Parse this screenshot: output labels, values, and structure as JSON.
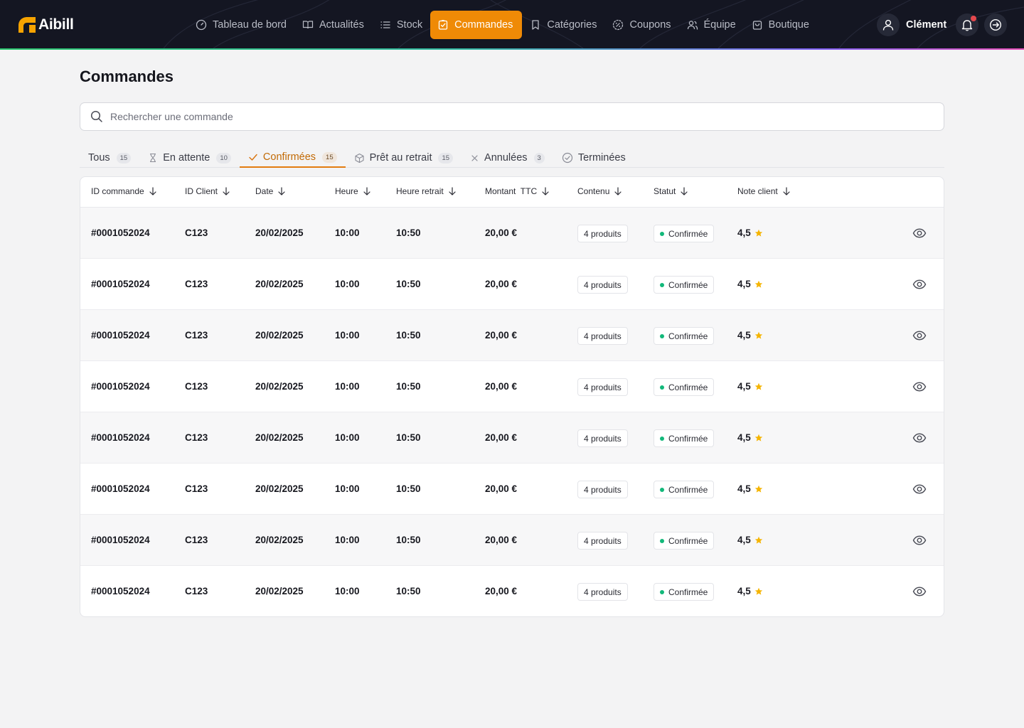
{
  "app": {
    "name": "Aibill"
  },
  "nav": {
    "items": [
      {
        "label": "Tableau de bord",
        "icon": "gauge-icon"
      },
      {
        "label": "Actualités",
        "icon": "book-open-icon"
      },
      {
        "label": "Stock",
        "icon": "list-icon"
      },
      {
        "label": "Commandes",
        "icon": "clipboard-check-icon",
        "active": true
      },
      {
        "label": "Catégories",
        "icon": "bookmark-icon"
      },
      {
        "label": "Coupons",
        "icon": "badge-percent-icon"
      },
      {
        "label": "Équipe",
        "icon": "users-icon"
      },
      {
        "label": "Boutique",
        "icon": "shopping-bag-icon"
      }
    ]
  },
  "user": {
    "name": "Clément"
  },
  "page": {
    "title": "Commandes"
  },
  "search": {
    "placeholder": "Rechercher une commande"
  },
  "tabs": [
    {
      "label": "Tous",
      "count": "15"
    },
    {
      "label": "En attente",
      "count": "10",
      "icon": "hourglass-icon"
    },
    {
      "label": "Confirmées",
      "count": "15",
      "icon": "check-icon",
      "active": true
    },
    {
      "label": "Prêt au retrait",
      "count": "15",
      "icon": "package-icon"
    },
    {
      "label": "Annulées",
      "count": "3",
      "icon": "x-icon"
    },
    {
      "label": "Terminées",
      "count": "",
      "icon": "check-circle-icon"
    }
  ],
  "table": {
    "columns": [
      "ID commande",
      "ID Client",
      "Date",
      "Heure",
      "Heure retrait",
      "Montant  TTC",
      "Contenu",
      "Statut",
      "Note client"
    ],
    "rows": [
      {
        "order_id": "#0001052024",
        "client_id": "C123",
        "date": "20/02/2025",
        "time": "10:00",
        "pickup_time": "10:50",
        "amount": "20,00 €",
        "content": "4 produits",
        "status": "Confirmée",
        "rating": "4,5"
      },
      {
        "order_id": "#0001052024",
        "client_id": "C123",
        "date": "20/02/2025",
        "time": "10:00",
        "pickup_time": "10:50",
        "amount": "20,00 €",
        "content": "4 produits",
        "status": "Confirmée",
        "rating": "4,5"
      },
      {
        "order_id": "#0001052024",
        "client_id": "C123",
        "date": "20/02/2025",
        "time": "10:00",
        "pickup_time": "10:50",
        "amount": "20,00 €",
        "content": "4 produits",
        "status": "Confirmée",
        "rating": "4,5"
      },
      {
        "order_id": "#0001052024",
        "client_id": "C123",
        "date": "20/02/2025",
        "time": "10:00",
        "pickup_time": "10:50",
        "amount": "20,00 €",
        "content": "4 produits",
        "status": "Confirmée",
        "rating": "4,5"
      },
      {
        "order_id": "#0001052024",
        "client_id": "C123",
        "date": "20/02/2025",
        "time": "10:00",
        "pickup_time": "10:50",
        "amount": "20,00 €",
        "content": "4 produits",
        "status": "Confirmée",
        "rating": "4,5"
      },
      {
        "order_id": "#0001052024",
        "client_id": "C123",
        "date": "20/02/2025",
        "time": "10:00",
        "pickup_time": "10:50",
        "amount": "20,00 €",
        "content": "4 produits",
        "status": "Confirmée",
        "rating": "4,5"
      },
      {
        "order_id": "#0001052024",
        "client_id": "C123",
        "date": "20/02/2025",
        "time": "10:00",
        "pickup_time": "10:50",
        "amount": "20,00 €",
        "content": "4 produits",
        "status": "Confirmée",
        "rating": "4,5"
      },
      {
        "order_id": "#0001052024",
        "client_id": "C123",
        "date": "20/02/2025",
        "time": "10:00",
        "pickup_time": "10:50",
        "amount": "20,00 €",
        "content": "4 produits",
        "status": "Confirmée",
        "rating": "4,5"
      }
    ]
  },
  "colors": {
    "accent": "#ef8a06",
    "topbar": "#141622",
    "status_confirmed": "#12b87a",
    "star": "#f5b400"
  }
}
